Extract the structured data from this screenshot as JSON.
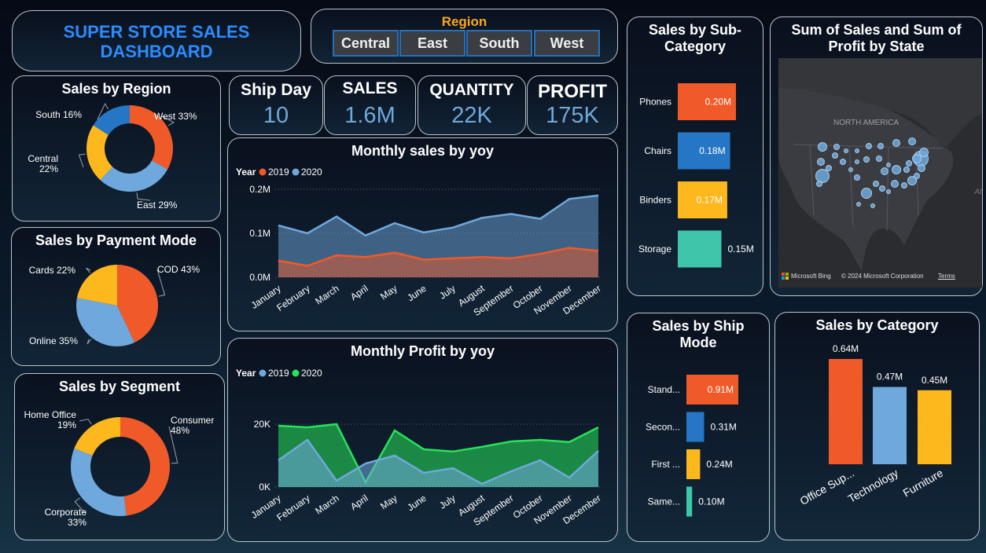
{
  "dashboard": {
    "title_line1": "SUPER STORE SALES",
    "title_line2": "DASHBOARD"
  },
  "slicer": {
    "title": "Region",
    "buttons": [
      "Central",
      "East",
      "South",
      "West"
    ]
  },
  "kpis": [
    {
      "label": "Ship Day",
      "value": "10"
    },
    {
      "label": "SALES",
      "value": "1.6M"
    },
    {
      "label": "QUANTITY",
      "value": "22K"
    },
    {
      "label": "PROFIT",
      "value": "175K"
    }
  ],
  "map": {
    "title_line1": "Sum of Sales and Sum of",
    "title_line2": "Profit by State",
    "region_label": "NORTH AMERICA",
    "edge_label": "Atl",
    "bing_label": "Microsoft Bing",
    "copyright": "© 2024 Microsoft Corporation",
    "terms": "Terms"
  },
  "colors": {
    "orange": "#f05a28",
    "blue": "#6fa8dc",
    "blue_dark": "#2577c6",
    "yellow": "#fdb81e",
    "teal": "#3fc5a9",
    "green": "#27e25a",
    "title_blue": "#2b8cff",
    "slicer_title": "#f7a81b"
  },
  "chart_data": [
    {
      "id": "sales_by_region",
      "type": "pie",
      "donut": true,
      "title": "Sales by Region",
      "slices": [
        {
          "label": "West",
          "pct": "33%",
          "value": 33,
          "color": "#f05a28"
        },
        {
          "label": "East",
          "pct": "29%",
          "value": 29,
          "color": "#6fa8dc"
        },
        {
          "label": "Central",
          "pct": "22%",
          "value": 22,
          "color": "#fdb81e"
        },
        {
          "label": "South",
          "pct": "16%",
          "value": 16,
          "color": "#2577c6"
        }
      ]
    },
    {
      "id": "sales_by_payment",
      "type": "pie",
      "donut": false,
      "title": "Sales by Payment Mode",
      "slices": [
        {
          "label": "COD",
          "pct": "43%",
          "value": 43,
          "color": "#f05a28"
        },
        {
          "label": "Online",
          "pct": "35%",
          "value": 35,
          "color": "#6fa8dc"
        },
        {
          "label": "Cards",
          "pct": "22%",
          "value": 22,
          "color": "#fdb81e"
        }
      ]
    },
    {
      "id": "sales_by_segment",
      "type": "pie",
      "donut": true,
      "title": "Sales by Segment",
      "slices": [
        {
          "label": "Consumer",
          "pct": "48%",
          "value": 48,
          "color": "#f05a28"
        },
        {
          "label": "Corporate",
          "pct": "33%",
          "value": 33,
          "color": "#6fa8dc"
        },
        {
          "label": "Home Office",
          "pct": "19%",
          "value": 19,
          "color": "#fdb81e"
        }
      ]
    },
    {
      "id": "monthly_sales",
      "type": "area",
      "title": "Monthly sales by yoy",
      "legend_title": "Year",
      "categories": [
        "January",
        "February",
        "March",
        "April",
        "May",
        "June",
        "July",
        "August",
        "September",
        "October",
        "November",
        "December"
      ],
      "y_ticks": [
        "0.0M",
        "0.1M",
        "0.2M"
      ],
      "ylim": [
        0,
        0.2
      ],
      "series": [
        {
          "name": "2019",
          "color": "#f05a28",
          "values": [
            0.038,
            0.026,
            0.05,
            0.046,
            0.056,
            0.04,
            0.043,
            0.046,
            0.043,
            0.053,
            0.067,
            0.06
          ]
        },
        {
          "name": "2020",
          "color": "#6fa8dc",
          "values": [
            0.118,
            0.1,
            0.138,
            0.095,
            0.123,
            0.102,
            0.113,
            0.135,
            0.144,
            0.133,
            0.178,
            0.186
          ]
        }
      ],
      "draw_order": [
        1,
        0
      ]
    },
    {
      "id": "monthly_profit",
      "type": "area",
      "title": "Monthly Profit by yoy",
      "legend_title": "Year",
      "categories": [
        "January",
        "February",
        "March",
        "April",
        "May",
        "June",
        "July",
        "August",
        "September",
        "October",
        "November",
        "December"
      ],
      "y_ticks": [
        "0K",
        "20K"
      ],
      "ylim": [
        0,
        26000
      ],
      "series": [
        {
          "name": "2019",
          "color": "#6fa8dc",
          "values": [
            8500,
            15000,
            2000,
            7500,
            10000,
            4500,
            6000,
            1000,
            5000,
            8500,
            3000,
            11500
          ]
        },
        {
          "name": "2020",
          "color": "#27e25a",
          "values": [
            19500,
            19000,
            20000,
            1500,
            18000,
            12000,
            11300,
            12800,
            14500,
            15000,
            14300,
            19000
          ]
        }
      ],
      "draw_order": [
        1,
        0
      ]
    },
    {
      "id": "sales_by_subcategory",
      "type": "bar",
      "orientation": "horizontal",
      "title": "Sales by Sub-Category",
      "categories": [
        "Phones",
        "Chairs",
        "Binders",
        "Storage"
      ],
      "values": [
        0.2,
        0.18,
        0.17,
        0.15
      ],
      "labels": [
        "0.20M",
        "0.18M",
        "0.17M",
        "0.15M"
      ],
      "colors": [
        "#f05a28",
        "#2577c6",
        "#fdb81e",
        "#3fc5a9"
      ]
    },
    {
      "id": "sales_by_shipmode",
      "type": "bar",
      "orientation": "horizontal",
      "title": "Sales by Ship Mode",
      "categories": [
        "Stand...",
        "Secon...",
        "First ...",
        "Same..."
      ],
      "values": [
        0.91,
        0.31,
        0.24,
        0.1
      ],
      "labels": [
        "0.91M",
        "0.31M",
        "0.24M",
        "0.10M"
      ],
      "colors": [
        "#f05a28",
        "#2577c6",
        "#fdb81e",
        "#3fc5a9"
      ]
    },
    {
      "id": "sales_by_category",
      "type": "bar",
      "orientation": "vertical",
      "title": "Sales by Category",
      "categories": [
        "Office Sup...",
        "Technology",
        "Furniture"
      ],
      "values": [
        0.64,
        0.47,
        0.45
      ],
      "labels": [
        "0.64M",
        "0.47M",
        "0.45M"
      ],
      "colors": [
        "#f05a28",
        "#6fa8dc",
        "#fdb81e"
      ]
    }
  ]
}
